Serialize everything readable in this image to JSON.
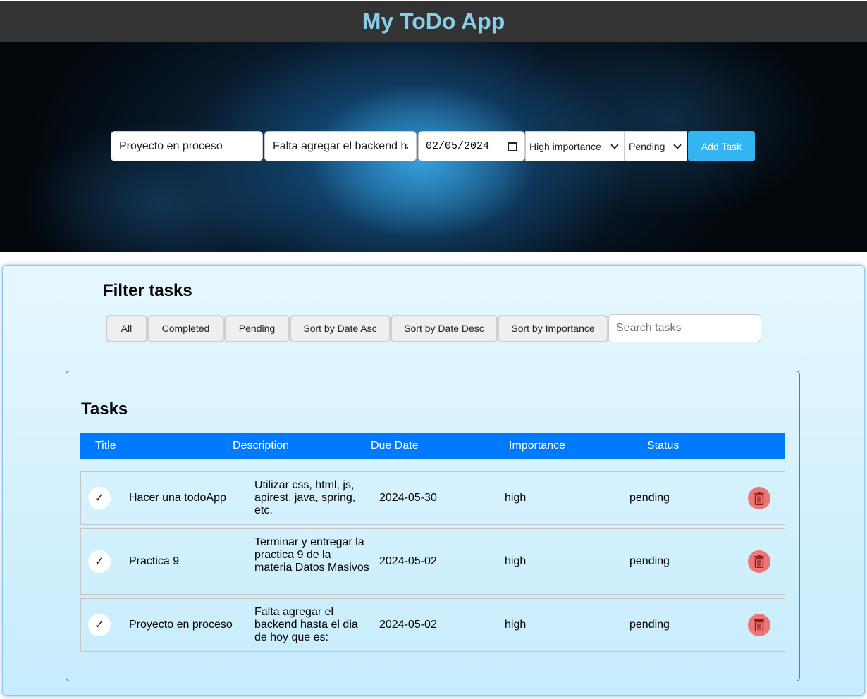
{
  "app": {
    "title": "My ToDo App"
  },
  "form": {
    "title_value": "Proyecto en proceso",
    "description_value": "Falta agregar el backend ha",
    "date_value": "02/05/2024",
    "importance_selected": "High importance",
    "status_selected": "Pending",
    "add_button": "Add Task"
  },
  "filter": {
    "heading": "Filter tasks",
    "buttons": [
      "All",
      "Completed",
      "Pending",
      "Sort by Date Asc",
      "Sort by Date Desc",
      "Sort by Importance"
    ],
    "search_placeholder": "Search tasks"
  },
  "tasks": {
    "heading": "Tasks",
    "columns": [
      "Title",
      "Description",
      "Due Date",
      "Importance",
      "Status"
    ],
    "rows": [
      {
        "check": "✓",
        "title": "Hacer una todoApp",
        "description": "Utilizar css, html, js, apirest, java, spring, etc.",
        "due": "2024-05-30",
        "importance": "high",
        "status": "pending"
      },
      {
        "check": "✓",
        "title": "Practica 9",
        "description": "Terminar y entregar la practica 9 de la materia Datos Masivos",
        "due": "2024-05-02",
        "importance": "high",
        "status": "pending"
      },
      {
        "check": "✓",
        "title": "Proyecto en proceso",
        "description": "Falta agregar el backend hasta el dia de hoy que es:",
        "due": "2024-05-02",
        "importance": "high",
        "status": "pending"
      }
    ]
  },
  "colors": {
    "header_bg": "#333333",
    "title": "#87ceeb",
    "accent": "#007bff",
    "add_button": "#33b5f2",
    "delete_button": "#ec7676"
  },
  "icons": {
    "complete": "check-icon",
    "delete": "trash-icon",
    "calendar": "calendar-icon",
    "dropdown": "chevron-down-icon"
  }
}
